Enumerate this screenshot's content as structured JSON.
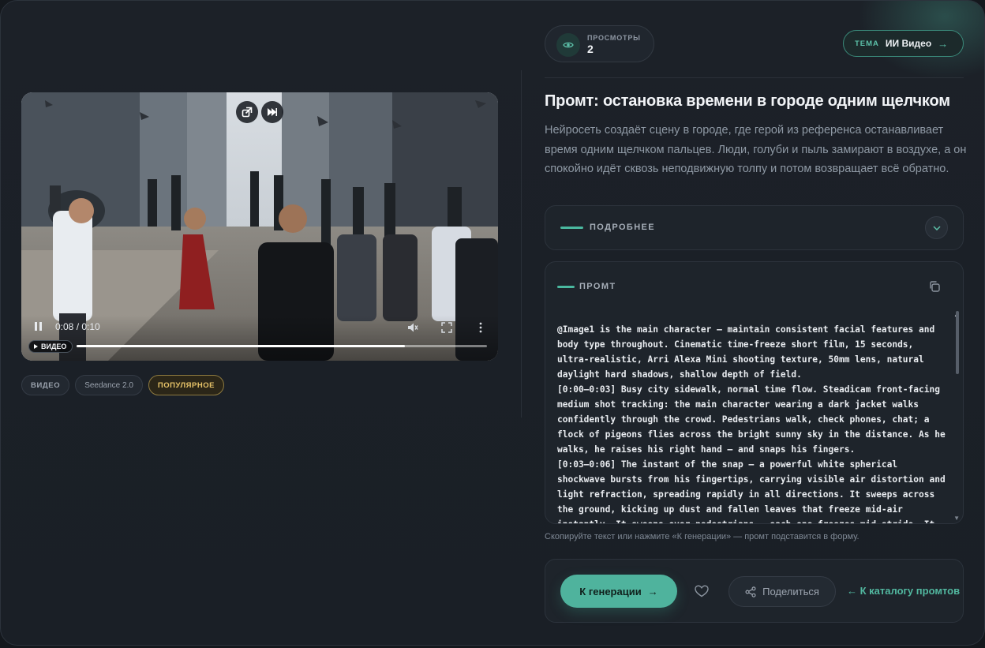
{
  "views": {
    "label": "ПРОСМОТРЫ",
    "count": "2"
  },
  "theme": {
    "label": "ТЕМА",
    "value": "ИИ Видео",
    "arrow": "→"
  },
  "video": {
    "time": "0:08 / 0:10",
    "progress_fraction": 0.8,
    "badge": "ВИДЕО"
  },
  "tags": [
    "ВИДЕО",
    "Seedance 2.0",
    "ПОПУЛЯРНОЕ"
  ],
  "title": "Промт: остановка времени в городе одним щелчком",
  "description": "Нейросеть создаёт сцену в городе, где герой из референса останавливает время одним щелчком пальцев. Люди, голуби и пыль замирают в воздухе, а он спокойно идёт сквозь неподвижную толпу и потом возвращает всё обратно.",
  "details": {
    "label": "ПОДРОБНЕЕ"
  },
  "prompt": {
    "label": "ПРОМТ",
    "text": "@Image1 is the main character — maintain consistent facial features and body type throughout. Cinematic time-freeze short film, 15 seconds, ultra-realistic, Arri Alexa Mini shooting texture, 50mm lens, natural daylight hard shadows, shallow depth of field.\n[0:00–0:03] Busy city sidewalk, normal time flow. Steadicam front-facing medium shot tracking: the main character wearing a dark jacket walks confidently through the crowd. Pedestrians walk, check phones, chat; a flock of pigeons flies across the bright sunny sky in the distance. As he walks, he raises his right hand — and snaps his fingers.\n[0:03–0:06] The instant of the snap — a powerful white spherical shockwave bursts from his fingertips, carrying visible air distortion and light refraction, spreading rapidly in all directions. It sweeps across the ground, kicking up dust and fallen leaves that freeze mid-air instantly. It sweeps over pedestrians — each one freezes mid-stride. It sweeps across the"
  },
  "hint": "Скопируйте текст или нажмите «К генерации» — промт подставится в форму.",
  "actions": {
    "generate": "К генерации",
    "generate_arrow": "→",
    "share": "Поделиться",
    "catalog": "← К каталогу промтов"
  },
  "colors": {
    "accent": "#4fb39d",
    "popular": "#e8c469",
    "background": "#1c2128"
  }
}
